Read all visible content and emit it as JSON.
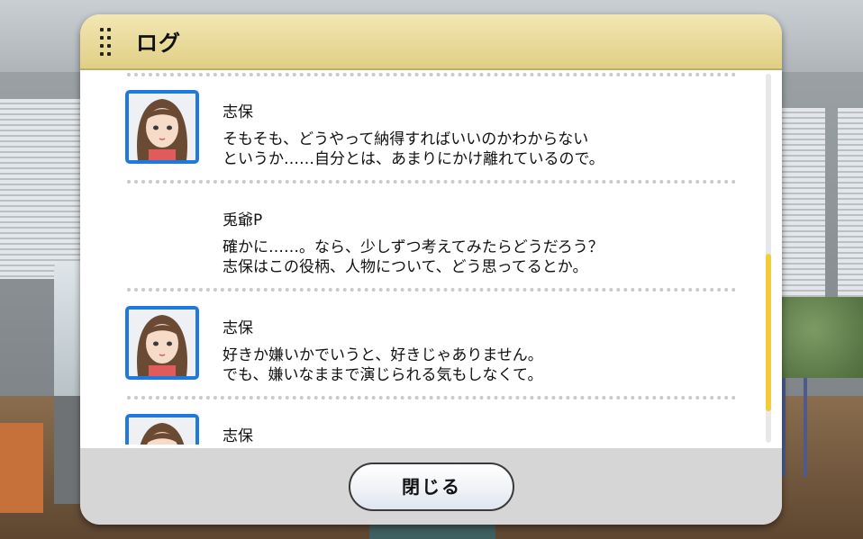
{
  "dialog": {
    "title": "ログ",
    "close_label": "閉じる"
  },
  "log": {
    "entries": [
      {
        "speaker": "志保",
        "has_avatar": true,
        "lines": [
          "そもそも、どうやって納得すればいいのかわからない",
          "というか……自分とは、あまりにかけ離れているので。"
        ]
      },
      {
        "speaker": "兎爺P",
        "has_avatar": false,
        "lines": [
          "確かに……。なら、少しずつ考えてみたらどうだろう？",
          "志保はこの役柄、人物について、どう思ってるとか。"
        ]
      },
      {
        "speaker": "志保",
        "has_avatar": true,
        "lines": [
          "好きか嫌いかでいうと、好きじゃありません。",
          "でも、嫌いなままで演じられる気もしなくて。"
        ]
      },
      {
        "speaker": "志保",
        "has_avatar": true,
        "lines": []
      }
    ]
  },
  "icons": {
    "grip": "grip-icon",
    "avatar": "shiho-avatar-icon"
  },
  "colors": {
    "header": "#e8d999",
    "avatar_border": "#1f7adf",
    "scroll_thumb": "#f3cc3a",
    "footer": "#d6d6d6"
  }
}
